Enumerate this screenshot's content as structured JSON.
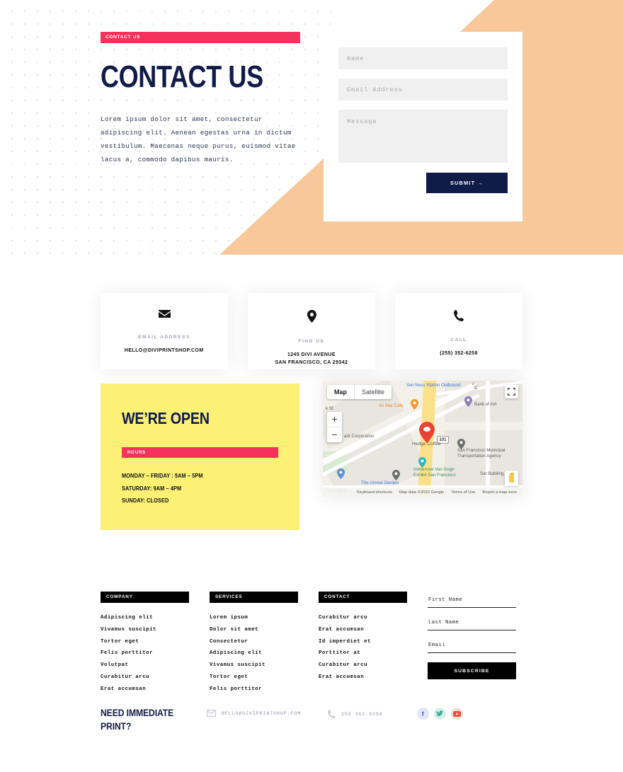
{
  "colors": {
    "navy": "#111b47",
    "pink": "#f5325b",
    "peach": "#f8c79a",
    "yellow": "#fcf175",
    "black": "#000000",
    "muted": "#9fa3b5"
  },
  "hero": {
    "eyebrow": "CONTACT US",
    "title": "CONTACT US",
    "body": "Lorem ipsum dolor sit amet, consectetur adipiscing elit. Aenean egestas urna in dictum vestibulum. Maecenas neque purus, euismod vitae lacus a, commodo dapibus mauris."
  },
  "form": {
    "name_placeholder": "Name",
    "email_placeholder": "Email Address",
    "message_placeholder": "Message",
    "submit_label": "SUBMIT →"
  },
  "info_cards": [
    {
      "icon": "envelope-icon",
      "label": "EMAIL ADDRESS",
      "value": "HELLO@DIVIPRINTSHOP.COM",
      "value2": ""
    },
    {
      "icon": "map-pin-icon",
      "label": "FIND US",
      "value": "1245 DIVI AVENUE",
      "value2": "SAN FRANCISCO, CA 29342"
    },
    {
      "icon": "phone-icon",
      "label": "CALL",
      "value": "(255) 352-6258",
      "value2": ""
    }
  ],
  "hours": {
    "title": "WE’RE OPEN",
    "bar_label": "HOURS",
    "items": [
      "MONDAY – FRIDAY : 9AM – 5PM",
      "SATURDAY: 9AM – 4PM",
      "SUNDAY: CLOSED"
    ]
  },
  "map": {
    "toggle_map": "Map",
    "toggle_satellite": "Satellite",
    "zoom_in": "+",
    "zoom_out": "−",
    "shield_label": "101",
    "markers": [
      {
        "label": "Van Ness Station Outbound",
        "color": "blue"
      },
      {
        "label": "All Star Cafe",
        "color": "orange"
      },
      {
        "label": "Bank of Am",
        "color": "gray"
      },
      {
        "label": "ark Corporation",
        "color": "gray"
      },
      {
        "label": "Hedge Coffee",
        "color": "gray"
      },
      {
        "label": "San Francisco Municipal Transportation Agency",
        "color": "gray"
      },
      {
        "label": "Immersive Van Gogh Exhibit San Francisco",
        "color": "green"
      },
      {
        "label": "The Unreal Garden",
        "color": "blue"
      },
      {
        "label": "Sar Building",
        "color": "gray"
      },
      {
        "label": "h St",
        "color": "gray"
      },
      {
        "label": "k St",
        "color": "gray"
      }
    ],
    "logo": "Google",
    "attribution": [
      "Keyboard shortcuts",
      "Map data ©2022 Google",
      "Terms of Use",
      "Report a map error"
    ]
  },
  "footer": {
    "columns": [
      {
        "heading": "COMPANY",
        "links": [
          "Adipiscing elit",
          "Vivamus suscipit",
          "Tortor eget",
          "Felis porttitor",
          "Volutpat",
          "Curabitur arcu",
          "Erat accumsan"
        ]
      },
      {
        "heading": "SERVICES",
        "links": [
          "Lorem ipsum",
          "Dolor sit amet",
          "Consectetur",
          "Adipiscing elit",
          "Vivamus suscipit",
          "Tortor eget",
          "Felis porttitor"
        ]
      },
      {
        "heading": "CONTACT",
        "links": [
          "Curabitur arcu",
          "Erat accumsan",
          "Id imperdiet et",
          "Porttitor at",
          "Curabitur arcu",
          "Erat accumsan"
        ]
      }
    ],
    "subscribe": {
      "first_name_placeholder": "First Name",
      "last_name_placeholder": "Last Name",
      "email_placeholder": "Email",
      "button_label": "SUBSCRIBE"
    },
    "bottom": {
      "title": "NEED IMMEDIATE PRINT?",
      "email": "HELLO@DIVIPRINTSHOP.COM",
      "phone": "255 352-6258",
      "social": [
        {
          "name": "facebook",
          "glyph": "f"
        },
        {
          "name": "twitter",
          "glyph": ""
        },
        {
          "name": "youtube",
          "glyph": ""
        }
      ]
    }
  }
}
